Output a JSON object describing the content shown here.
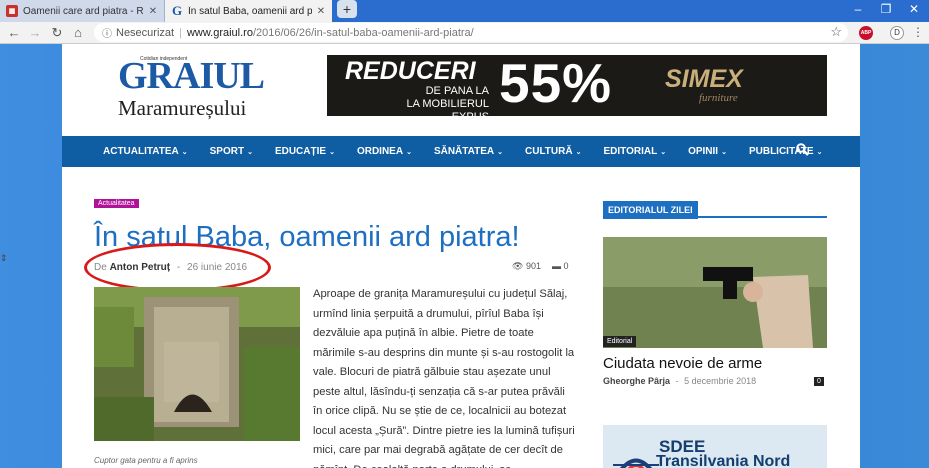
{
  "browser": {
    "tabs": [
      {
        "title": "Oamenii care ard piatra - Report",
        "active": false
      },
      {
        "title": "În satul Baba, oamenii ard piatra!",
        "active": true
      }
    ],
    "address": {
      "security": "Nesecurizat",
      "domain": "www.graiul.ro",
      "path": "/2016/06/26/in-satul-baba-oamenii-ard-piatra/"
    },
    "profile_initial": "D",
    "extension": "ABP"
  },
  "site": {
    "logo_top": "GRAIUL",
    "logo_tagline": "Cotidian independent",
    "logo_bottom": "Maramureșului",
    "banner": {
      "line1": "REDUCERI",
      "line2": "DE PANA LA",
      "line3": "LA MOBILIERUL EXPUS",
      "percent": "55%",
      "brand": "SIMEX",
      "brand_sub": "furniture"
    },
    "nav": [
      "ACTUALITATEA",
      "SPORT",
      "EDUCAȚIE",
      "ORDINEA",
      "SĂNĂTATEA",
      "CULTURĂ",
      "EDITORIAL",
      "OPINII",
      "PUBLICITATE"
    ]
  },
  "article": {
    "category": "Actualitatea",
    "title": "În satul Baba, oamenii ard piatra!",
    "by": "De",
    "author": "Anton Petruț",
    "dash": "-",
    "date": "26 iunie 2016",
    "views": "901",
    "comments": "0",
    "caption": "Cuptor gata pentru a fi aprins",
    "body": "Aproape de granița Maramureșului cu județul Sălaj, urmînd linia șerpuită a drumului, pîrîul Baba își dezvăluie apa puțină în albie. Pietre de toate mărimile s-au desprins din munte și s-au rostogolit la vale. Blocuri de piatră gălbuie stau așezate unul peste altul, lăsîndu-ți senzația că s-ar putea prăvăli în orice clipă. Nu se știe de ce, localnicii au botezat locul acesta „Șură”. Dintre pietre ies la lumină tufișuri mici, care par mai degrabă agățate de cer decît de pămînt. De cealaltă parte a drumului, se"
  },
  "sidebar": {
    "heading": "EDITORIALUL ZILEI",
    "tag": "Editorial",
    "title": "Ciudata nevoie de arme",
    "author": "Gheorghe Pârja",
    "dash": "-",
    "date": "5 decembrie 2018",
    "count": "0",
    "ad_line1": "SDEE",
    "ad_line2": "Transilvania Nord"
  },
  "colors": {
    "accent": "#1d6fc2",
    "nav": "#0f5da2",
    "category": "#b0139a",
    "annotation": "#d91818"
  }
}
